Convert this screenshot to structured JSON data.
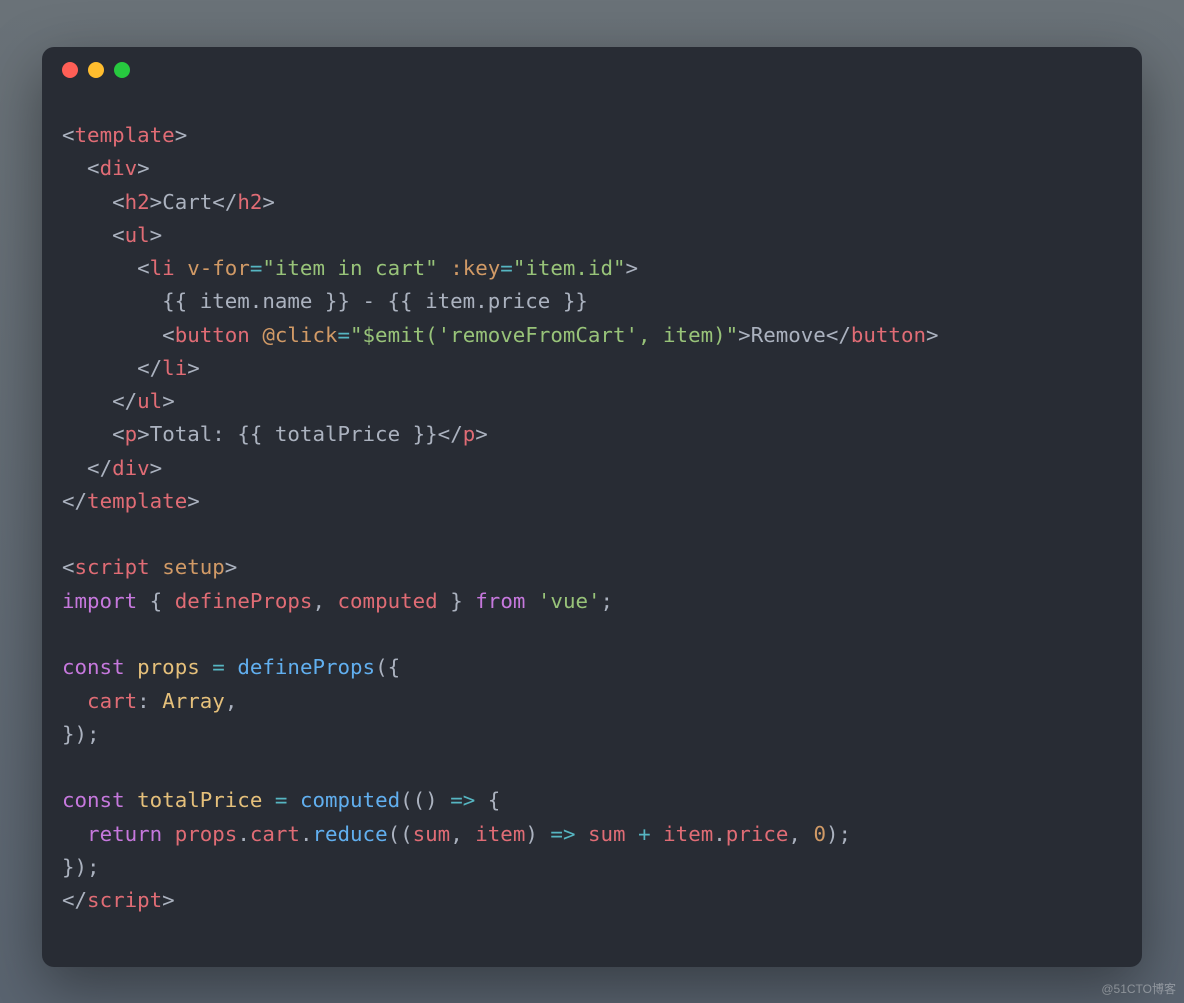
{
  "watermark": "@51CTO博客",
  "code": {
    "tokens": [
      {
        "t": "ang",
        "v": "<"
      },
      {
        "t": "tag",
        "v": "template"
      },
      {
        "t": "ang",
        "v": ">"
      },
      {
        "t": "nl"
      },
      {
        "t": "txt",
        "v": "  "
      },
      {
        "t": "ang",
        "v": "<"
      },
      {
        "t": "tag",
        "v": "div"
      },
      {
        "t": "ang",
        "v": ">"
      },
      {
        "t": "nl"
      },
      {
        "t": "txt",
        "v": "    "
      },
      {
        "t": "ang",
        "v": "<"
      },
      {
        "t": "tag",
        "v": "h2"
      },
      {
        "t": "ang",
        "v": ">"
      },
      {
        "t": "txt",
        "v": "Cart"
      },
      {
        "t": "ang",
        "v": "</"
      },
      {
        "t": "tag",
        "v": "h2"
      },
      {
        "t": "ang",
        "v": ">"
      },
      {
        "t": "nl"
      },
      {
        "t": "txt",
        "v": "    "
      },
      {
        "t": "ang",
        "v": "<"
      },
      {
        "t": "tag",
        "v": "ul"
      },
      {
        "t": "ang",
        "v": ">"
      },
      {
        "t": "nl"
      },
      {
        "t": "txt",
        "v": "      "
      },
      {
        "t": "ang",
        "v": "<"
      },
      {
        "t": "tag",
        "v": "li"
      },
      {
        "t": "txt",
        "v": " "
      },
      {
        "t": "attr",
        "v": "v-for"
      },
      {
        "t": "op",
        "v": "="
      },
      {
        "t": "str",
        "v": "\"item in cart\""
      },
      {
        "t": "txt",
        "v": " "
      },
      {
        "t": "attr",
        "v": ":key"
      },
      {
        "t": "op",
        "v": "="
      },
      {
        "t": "str",
        "v": "\"item.id\""
      },
      {
        "t": "ang",
        "v": ">"
      },
      {
        "t": "nl"
      },
      {
        "t": "txt",
        "v": "        {{ item.name }} - {{ item.price }}"
      },
      {
        "t": "nl"
      },
      {
        "t": "txt",
        "v": "        "
      },
      {
        "t": "ang",
        "v": "<"
      },
      {
        "t": "tag",
        "v": "button"
      },
      {
        "t": "txt",
        "v": " "
      },
      {
        "t": "attr",
        "v": "@click"
      },
      {
        "t": "op",
        "v": "="
      },
      {
        "t": "str",
        "v": "\"$emit('removeFromCart', item)\""
      },
      {
        "t": "ang",
        "v": ">"
      },
      {
        "t": "txt",
        "v": "Remove"
      },
      {
        "t": "ang",
        "v": "</"
      },
      {
        "t": "tag",
        "v": "button"
      },
      {
        "t": "ang",
        "v": ">"
      },
      {
        "t": "nl"
      },
      {
        "t": "txt",
        "v": "      "
      },
      {
        "t": "ang",
        "v": "</"
      },
      {
        "t": "tag",
        "v": "li"
      },
      {
        "t": "ang",
        "v": ">"
      },
      {
        "t": "nl"
      },
      {
        "t": "txt",
        "v": "    "
      },
      {
        "t": "ang",
        "v": "</"
      },
      {
        "t": "tag",
        "v": "ul"
      },
      {
        "t": "ang",
        "v": ">"
      },
      {
        "t": "nl"
      },
      {
        "t": "txt",
        "v": "    "
      },
      {
        "t": "ang",
        "v": "<"
      },
      {
        "t": "tag",
        "v": "p"
      },
      {
        "t": "ang",
        "v": ">"
      },
      {
        "t": "txt",
        "v": "Total: {{ totalPrice }}"
      },
      {
        "t": "ang",
        "v": "</"
      },
      {
        "t": "tag",
        "v": "p"
      },
      {
        "t": "ang",
        "v": ">"
      },
      {
        "t": "nl"
      },
      {
        "t": "txt",
        "v": "  "
      },
      {
        "t": "ang",
        "v": "</"
      },
      {
        "t": "tag",
        "v": "div"
      },
      {
        "t": "ang",
        "v": ">"
      },
      {
        "t": "nl"
      },
      {
        "t": "ang",
        "v": "</"
      },
      {
        "t": "tag",
        "v": "template"
      },
      {
        "t": "ang",
        "v": ">"
      },
      {
        "t": "nl"
      },
      {
        "t": "nl"
      },
      {
        "t": "ang",
        "v": "<"
      },
      {
        "t": "tag",
        "v": "script"
      },
      {
        "t": "txt",
        "v": " "
      },
      {
        "t": "attr",
        "v": "setup"
      },
      {
        "t": "ang",
        "v": ">"
      },
      {
        "t": "nl"
      },
      {
        "t": "kw",
        "v": "import"
      },
      {
        "t": "txt",
        "v": " "
      },
      {
        "t": "pun",
        "v": "{"
      },
      {
        "t": "txt",
        "v": " "
      },
      {
        "t": "var",
        "v": "defineProps"
      },
      {
        "t": "pun",
        "v": ","
      },
      {
        "t": "txt",
        "v": " "
      },
      {
        "t": "var",
        "v": "computed"
      },
      {
        "t": "txt",
        "v": " "
      },
      {
        "t": "pun",
        "v": "}"
      },
      {
        "t": "txt",
        "v": " "
      },
      {
        "t": "kw",
        "v": "from"
      },
      {
        "t": "txt",
        "v": " "
      },
      {
        "t": "str",
        "v": "'vue'"
      },
      {
        "t": "pun",
        "v": ";"
      },
      {
        "t": "nl"
      },
      {
        "t": "nl"
      },
      {
        "t": "kw",
        "v": "const"
      },
      {
        "t": "txt",
        "v": " "
      },
      {
        "t": "id",
        "v": "props"
      },
      {
        "t": "txt",
        "v": " "
      },
      {
        "t": "op",
        "v": "="
      },
      {
        "t": "txt",
        "v": " "
      },
      {
        "t": "fn",
        "v": "defineProps"
      },
      {
        "t": "pun",
        "v": "({"
      },
      {
        "t": "nl"
      },
      {
        "t": "txt",
        "v": "  "
      },
      {
        "t": "var",
        "v": "cart"
      },
      {
        "t": "pun",
        "v": ":"
      },
      {
        "t": "txt",
        "v": " "
      },
      {
        "t": "id",
        "v": "Array"
      },
      {
        "t": "pun",
        "v": ","
      },
      {
        "t": "nl"
      },
      {
        "t": "pun",
        "v": "});"
      },
      {
        "t": "nl"
      },
      {
        "t": "nl"
      },
      {
        "t": "kw",
        "v": "const"
      },
      {
        "t": "txt",
        "v": " "
      },
      {
        "t": "id",
        "v": "totalPrice"
      },
      {
        "t": "txt",
        "v": " "
      },
      {
        "t": "op",
        "v": "="
      },
      {
        "t": "txt",
        "v": " "
      },
      {
        "t": "fn",
        "v": "computed"
      },
      {
        "t": "pun",
        "v": "(()"
      },
      {
        "t": "txt",
        "v": " "
      },
      {
        "t": "op",
        "v": "=>"
      },
      {
        "t": "txt",
        "v": " "
      },
      {
        "t": "pun",
        "v": "{"
      },
      {
        "t": "nl"
      },
      {
        "t": "txt",
        "v": "  "
      },
      {
        "t": "kw",
        "v": "return"
      },
      {
        "t": "txt",
        "v": " "
      },
      {
        "t": "var",
        "v": "props"
      },
      {
        "t": "pun",
        "v": "."
      },
      {
        "t": "var",
        "v": "cart"
      },
      {
        "t": "pun",
        "v": "."
      },
      {
        "t": "fn",
        "v": "reduce"
      },
      {
        "t": "pun",
        "v": "(("
      },
      {
        "t": "var",
        "v": "sum"
      },
      {
        "t": "pun",
        "v": ","
      },
      {
        "t": "txt",
        "v": " "
      },
      {
        "t": "var",
        "v": "item"
      },
      {
        "t": "pun",
        "v": ")"
      },
      {
        "t": "txt",
        "v": " "
      },
      {
        "t": "op",
        "v": "=>"
      },
      {
        "t": "txt",
        "v": " "
      },
      {
        "t": "var",
        "v": "sum"
      },
      {
        "t": "txt",
        "v": " "
      },
      {
        "t": "op",
        "v": "+"
      },
      {
        "t": "txt",
        "v": " "
      },
      {
        "t": "var",
        "v": "item"
      },
      {
        "t": "pun",
        "v": "."
      },
      {
        "t": "var",
        "v": "price"
      },
      {
        "t": "pun",
        "v": ","
      },
      {
        "t": "txt",
        "v": " "
      },
      {
        "t": "num",
        "v": "0"
      },
      {
        "t": "pun",
        "v": ");"
      },
      {
        "t": "nl"
      },
      {
        "t": "pun",
        "v": "});"
      },
      {
        "t": "nl"
      },
      {
        "t": "ang",
        "v": "</"
      },
      {
        "t": "tag",
        "v": "script"
      },
      {
        "t": "ang",
        "v": ">"
      }
    ]
  }
}
